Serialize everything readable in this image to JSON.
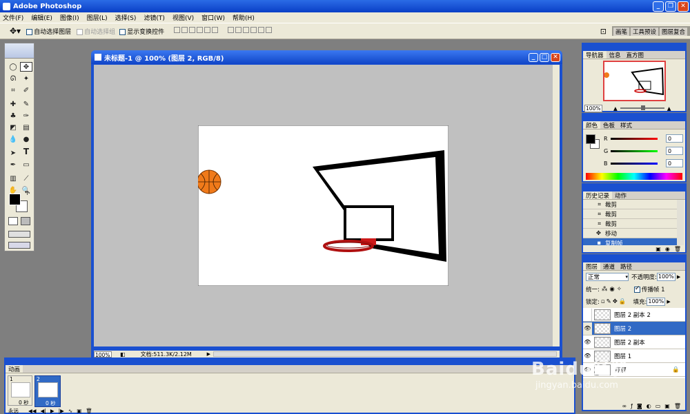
{
  "app_title": "Adobe Photoshop",
  "menu": [
    "文件(F)",
    "编辑(E)",
    "图像(I)",
    "图层(L)",
    "选择(S)",
    "滤镜(T)",
    "视图(V)",
    "窗口(W)",
    "帮助(H)"
  ],
  "options": {
    "auto_select_layer": "自动选择图层",
    "auto_select_group": "自动选择组",
    "show_transform": "显示变换控件",
    "tabs": [
      "画笔",
      "工具预设",
      "图层复合"
    ]
  },
  "document": {
    "title": "未标题-1 @ 100% (图层 2, RGB/8)",
    "zoom": "100%",
    "doc_info": "文档:511.3K/2.12M"
  },
  "navigator": {
    "tabs": [
      "导航器",
      "信息",
      "直方图"
    ],
    "zoom": "100%"
  },
  "color_panel": {
    "tabs": [
      "颜色",
      "色板",
      "样式"
    ],
    "channels": [
      {
        "label": "R",
        "value": "0",
        "color": "#c00000"
      },
      {
        "label": "G",
        "value": "0",
        "color": "#00a000"
      },
      {
        "label": "B",
        "value": "0",
        "color": "#0000c0"
      }
    ]
  },
  "history": {
    "tabs": [
      "历史记录",
      "动作"
    ],
    "items": [
      "裁剪",
      "裁剪",
      "裁剪",
      "移动",
      "复制帧"
    ]
  },
  "layers": {
    "tabs": [
      "图层",
      "通道",
      "路径"
    ],
    "blend_mode": "正常",
    "opacity_label": "不透明度:",
    "opacity": "100%",
    "unify_label": "统一:",
    "propagate_label": "传播帧 1",
    "lock_label": "锁定:",
    "fill_label": "填充:",
    "fill": "100%",
    "items": [
      "图层 2 副本 2",
      "图层 2",
      "图层 2 副本",
      "图层 1",
      "背景"
    ]
  },
  "animation": {
    "tab": "动画",
    "frames": [
      {
        "number": "1",
        "delay": "0 秒"
      },
      {
        "number": "2",
        "delay": "0 秒"
      }
    ],
    "loop": "永远"
  },
  "watermark": {
    "brand": "Baidu经验",
    "url": "jingyan.baidu.com"
  },
  "colors": {
    "xp_blue": "#1a50d0",
    "panel_bg": "#ece9d8",
    "selection": "#316ac5",
    "ball": "#f07a1a",
    "rim": "#cc1a1a"
  }
}
